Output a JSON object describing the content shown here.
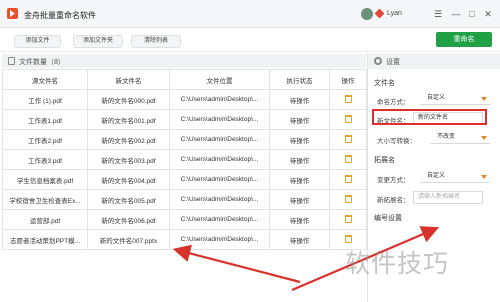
{
  "app": {
    "title": "金舟批量重命名软件",
    "username": "Lyan"
  },
  "window_controls": {
    "menu": "☰",
    "minimize": "—",
    "restore": "□",
    "close": "✕"
  },
  "toolbar": {
    "add_file": "添加文件",
    "add_folder": "添加文件夹",
    "clear_list": "清除列表",
    "rename": "重命名"
  },
  "file_list": {
    "count_label": "文件数量（8）",
    "columns": [
      "源文件名",
      "新文件名",
      "文件位置",
      "执行状态",
      "操作"
    ],
    "rows": [
      {
        "src": "工作 (1).pdf",
        "new": "新的文件名000.pdf",
        "path": "C:\\Users\\admin\\Desktop\\...",
        "status": "待操作"
      },
      {
        "src": "工作表1.pdf",
        "new": "新的文件名001.pdf",
        "path": "C:\\Users\\admin\\Desktop\\...",
        "status": "待操作"
      },
      {
        "src": "工作表2.pdf",
        "new": "新的文件名002.pdf",
        "path": "C:\\Users\\admin\\Desktop\\...",
        "status": "待操作"
      },
      {
        "src": "工作表3.pdf",
        "new": "新的文件名003.pdf",
        "path": "C:\\Users\\admin\\Desktop\\...",
        "status": "待操作"
      },
      {
        "src": "学生信息档案表.pdf",
        "new": "新的文件名004.pdf",
        "path": "C:\\Users\\admin\\Desktop\\...",
        "status": "待操作"
      },
      {
        "src": "学校宿舍卫生检查表Ex...",
        "new": "新的文件名005.pdf",
        "path": "C:\\Users\\admin\\Desktop\\...",
        "status": "待操作"
      },
      {
        "src": "运营部.pdf",
        "new": "新的文件名006.pdf",
        "path": "C:\\Users\\admin\\Desktop\\...",
        "status": "待操作"
      },
      {
        "src": "志愿者活动策划PPT模...",
        "new": "新的文件名007.pptx",
        "path": "C:\\Users\\admin\\Desktop\\...",
        "status": "待操作"
      }
    ]
  },
  "settings": {
    "title": "设置",
    "filename_section": "文件名",
    "naming_mode_label": "命名方式：",
    "naming_mode_value": "自定义",
    "new_name_label": "新文件名：",
    "new_name_value": "新的文件名",
    "case_label": "大小写转换：",
    "case_value": "不改变",
    "ext_section": "拓展名",
    "change_mode_label": "变更方式：",
    "change_mode_value": "自定义",
    "new_ext_label": "新拓展名：",
    "new_ext_placeholder": "请输入新拓展名",
    "numbering_section": "编号设置"
  },
  "watermark": "软件技巧",
  "colors": {
    "accent_green": "#21a146",
    "highlight_red": "#d9312b",
    "dropdown_orange": "#e8842b"
  }
}
